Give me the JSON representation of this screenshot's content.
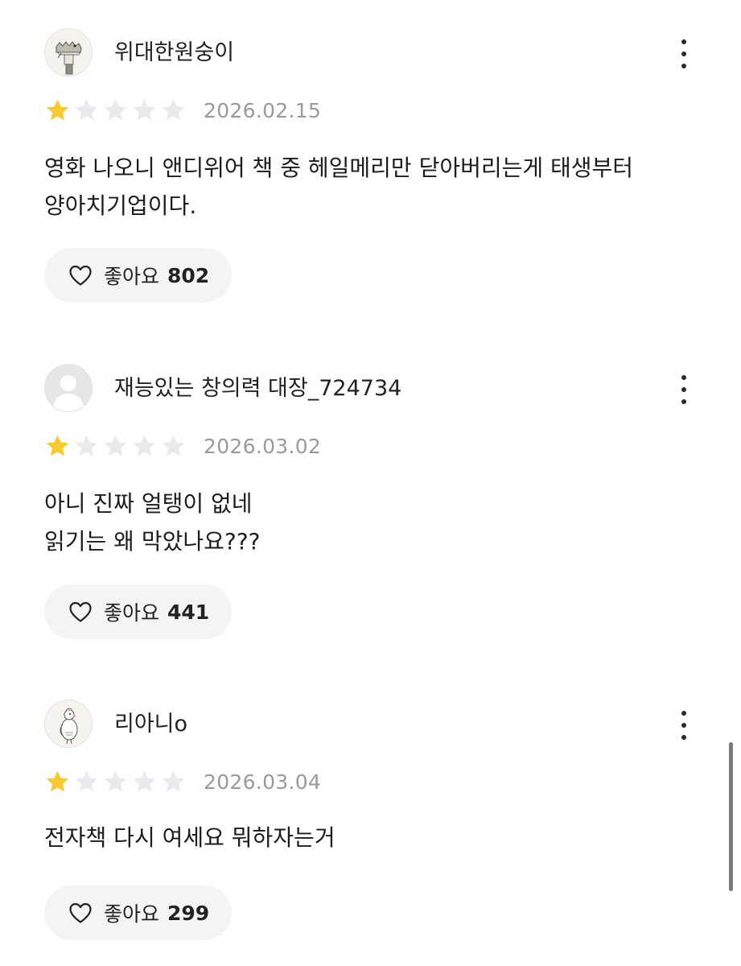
{
  "reviews": [
    {
      "nickname": "위대한원숭이",
      "avatar_icon": "crocodile-illustration-icon",
      "rating": 1,
      "max_rating": 5,
      "date": "2026.02.15",
      "body": "영화 나오니 앤디위어 책 중 헤일메리만 닫아버리는게 태생부터\n양아치기업이다.",
      "like_label": "좋아요",
      "like_count": "802"
    },
    {
      "nickname": "재능있는 창의력 대장_724734",
      "avatar_icon": "default-user-icon",
      "rating": 1,
      "max_rating": 5,
      "date": "2026.03.02",
      "body": "아니 진짜 얼탱이 없네\n읽기는 왜 막았나요???",
      "like_label": "좋아요",
      "like_count": "441"
    },
    {
      "nickname": "리아니o",
      "avatar_icon": "bird-illustration-icon",
      "rating": 1,
      "max_rating": 5,
      "date": "2026.03.04",
      "body": "전자책 다시 여세요 뭐하자는거",
      "like_label": "좋아요",
      "like_count": "299"
    }
  ],
  "more_icon": "more-vertical-icon",
  "like_icon": "heart-outline-icon",
  "colors": {
    "star_filled": "#F7CB2F",
    "star_empty": "#E9E9EE",
    "date": "#9A9A9A",
    "like_button_bg": "#F4F4F4"
  }
}
